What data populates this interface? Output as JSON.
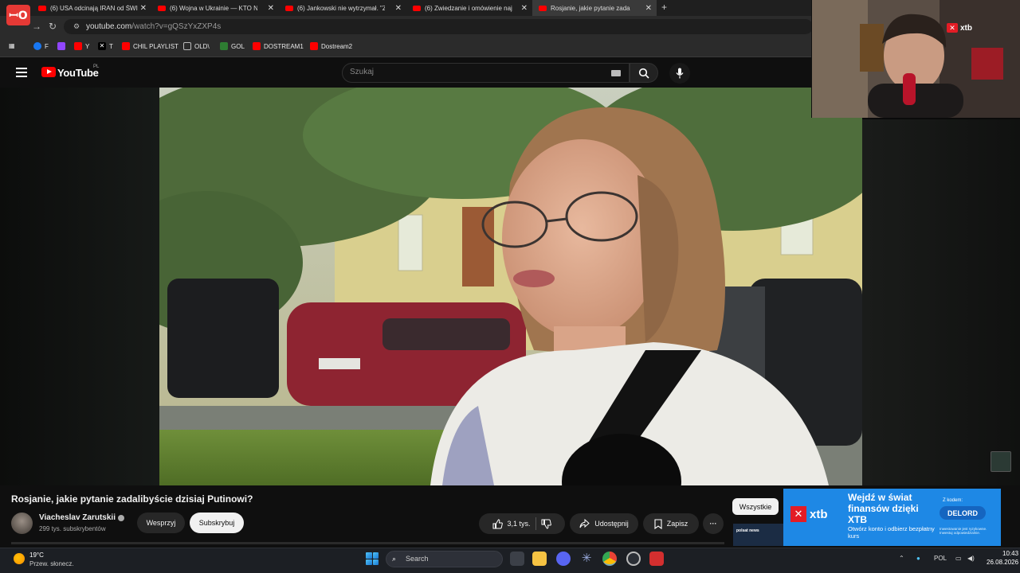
{
  "browser": {
    "tabs": [
      {
        "label": "(6) USA odcinają IRAN od ŚWIA",
        "active": false
      },
      {
        "label": "(6) Wojna w Ukrainie — KTO N",
        "active": false
      },
      {
        "label": "(6) Jankowski nie wytrzymał. \"Z",
        "active": false
      },
      {
        "label": "(6) Zwiedzanie i omówienie naj",
        "active": false
      },
      {
        "label": "Rosjanie, jakie pytanie zada",
        "active": true
      }
    ],
    "stream_logo": "ꟷO",
    "new_tab": "+",
    "url_host": "youtube.com",
    "url_path": "/watch?v=gQSzYxZXP4s",
    "bookmarks": [
      {
        "label": "F",
        "color": "#1877f2"
      },
      {
        "label": "",
        "color": "#9146ff"
      },
      {
        "label": "Y",
        "color": "#ff0000"
      },
      {
        "label": "T",
        "color": "#000000"
      },
      {
        "label": "CHIL PLAYLIST",
        "color": "#ff0000"
      },
      {
        "label": "OLD\\",
        "color": "#888888"
      },
      {
        "label": "GOL",
        "color": "#2e7d32"
      },
      {
        "label": "DOSTREAM1",
        "color": "#ff0000"
      },
      {
        "label": "Dostream2",
        "color": "#ff0000"
      }
    ]
  },
  "youtube": {
    "logo_text": "YouTube",
    "country": "PL",
    "search_placeholder": "Szukaj"
  },
  "video": {
    "title": "Rosjanie, jakie pytanie zadalibyście dzisiaj Putinowi?",
    "channel": "Viacheslav Zarutskii",
    "subscribers": "299 tys. subskrybentów",
    "support_label": "Wesprzyj",
    "subscribe_label": "Subskrybuj",
    "likes": "3,1 tys.",
    "share_label": "Udostępnij",
    "save_label": "Zapisz",
    "more_label": "···"
  },
  "sidebar": {
    "filter_chip": "Wszystkie",
    "thumb_label": "polsat news"
  },
  "ad": {
    "brand": "xtb",
    "headline": "Wejdź w świat finansów dzięki XTB",
    "subline": "Otwórz konto i odbierz bezpłatny kurs",
    "code_label": "Z kodem:",
    "code": "DELORD",
    "disclaimer": "Inwestowanie jest ryzykowne. Inwestuj odpowiedzialnie."
  },
  "webcam": {
    "sponsor": "xtb"
  },
  "taskbar": {
    "weather_temp": "19°C",
    "weather_desc": "Przew. słonecz.",
    "search_label": "Search",
    "language": "POL",
    "time": "10:43",
    "date": "26.08.2026"
  },
  "colors": {
    "youtube_red": "#ff0000",
    "xtb_red": "#e31c25",
    "ad_blue": "#1e88e5"
  }
}
